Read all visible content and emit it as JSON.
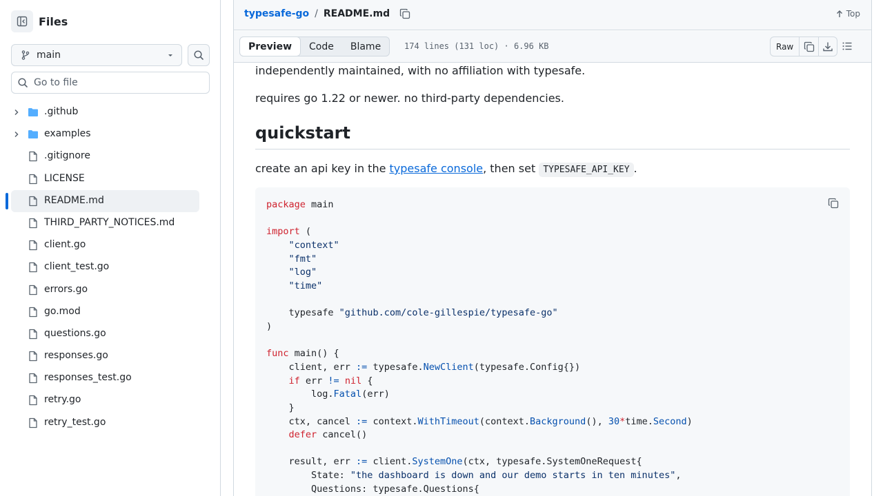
{
  "sidebar": {
    "title": "Files",
    "branch": "main",
    "goto_placeholder": "Go to file",
    "items": [
      {
        "name": ".github",
        "type": "folder"
      },
      {
        "name": "examples",
        "type": "folder"
      },
      {
        "name": ".gitignore",
        "type": "file"
      },
      {
        "name": "LICENSE",
        "type": "file"
      },
      {
        "name": "README.md",
        "type": "file",
        "selected": true
      },
      {
        "name": "THIRD_PARTY_NOTICES.md",
        "type": "file"
      },
      {
        "name": "client.go",
        "type": "file"
      },
      {
        "name": "client_test.go",
        "type": "file"
      },
      {
        "name": "errors.go",
        "type": "file"
      },
      {
        "name": "go.mod",
        "type": "file"
      },
      {
        "name": "questions.go",
        "type": "file"
      },
      {
        "name": "responses.go",
        "type": "file"
      },
      {
        "name": "responses_test.go",
        "type": "file"
      },
      {
        "name": "retry.go",
        "type": "file"
      },
      {
        "name": "retry_test.go",
        "type": "file"
      }
    ]
  },
  "header": {
    "repo": "typesafe-go",
    "separator": "/",
    "file": "README.md",
    "top_label": "Top"
  },
  "toolbar": {
    "tabs": [
      "Preview",
      "Code",
      "Blame"
    ],
    "active_tab": "Preview",
    "meta": "174 lines (131 loc) · 6.96 KB",
    "raw_label": "Raw"
  },
  "readme": {
    "p1": "independently maintained, with no affiliation with typesafe.",
    "p2": "requires go 1.22 or newer. no third-party dependencies.",
    "heading": "quickstart",
    "p3_before": "create an api key in the ",
    "p3_link": "typesafe console",
    "p3_middle": ", then set ",
    "p3_code": "TYPESAFE_API_KEY",
    "p3_after": ".",
    "code_lines": [
      [
        [
          "kw",
          "package"
        ],
        [
          "t",
          " main"
        ]
      ],
      [],
      [
        [
          "kw",
          "import"
        ],
        [
          "t",
          " ("
        ]
      ],
      [
        [
          "t",
          "    "
        ],
        [
          "str",
          "\"context\""
        ]
      ],
      [
        [
          "t",
          "    "
        ],
        [
          "str",
          "\"fmt\""
        ]
      ],
      [
        [
          "t",
          "    "
        ],
        [
          "str",
          "\"log\""
        ]
      ],
      [
        [
          "t",
          "    "
        ],
        [
          "str",
          "\"time\""
        ]
      ],
      [],
      [
        [
          "t",
          "    typesafe "
        ],
        [
          "str",
          "\"github.com/cole-gillespie/typesafe-go\""
        ]
      ],
      [
        [
          "t",
          ")"
        ]
      ],
      [],
      [
        [
          "kw",
          "func"
        ],
        [
          "t",
          " main() {"
        ]
      ],
      [
        [
          "t",
          "    client, err "
        ],
        [
          "op",
          ":="
        ],
        [
          "t",
          " typesafe."
        ],
        [
          "fn",
          "NewClient"
        ],
        [
          "t",
          "(typesafe.Config{})"
        ]
      ],
      [
        [
          "t",
          "    "
        ],
        [
          "kw",
          "if"
        ],
        [
          "t",
          " err "
        ],
        [
          "op",
          "!="
        ],
        [
          "t",
          " "
        ],
        [
          "kw",
          "nil"
        ],
        [
          "t",
          " {"
        ]
      ],
      [
        [
          "t",
          "        log."
        ],
        [
          "fn",
          "Fatal"
        ],
        [
          "t",
          "(err)"
        ]
      ],
      [
        [
          "t",
          "    }"
        ]
      ],
      [
        [
          "t",
          "    ctx, cancel "
        ],
        [
          "op",
          ":="
        ],
        [
          "t",
          " context."
        ],
        [
          "fn",
          "WithTimeout"
        ],
        [
          "t",
          "(context."
        ],
        [
          "fn",
          "Background"
        ],
        [
          "t",
          "(), "
        ],
        [
          "op",
          "30"
        ],
        [
          "kw",
          "*"
        ],
        [
          "t",
          "time."
        ],
        [
          "fn",
          "Second"
        ],
        [
          "t",
          ")"
        ]
      ],
      [
        [
          "t",
          "    "
        ],
        [
          "kw",
          "defer"
        ],
        [
          "t",
          " cancel()"
        ]
      ],
      [],
      [
        [
          "t",
          "    result, err "
        ],
        [
          "op",
          ":="
        ],
        [
          "t",
          " client."
        ],
        [
          "fn",
          "SystemOne"
        ],
        [
          "t",
          "(ctx, typesafe.SystemOneRequest{"
        ]
      ],
      [
        [
          "t",
          "        State: "
        ],
        [
          "str",
          "\"the dashboard is down and our demo starts in ten minutes\""
        ],
        [
          "t",
          ","
        ]
      ],
      [
        [
          "t",
          "        Questions: typesafe.Questions{"
        ]
      ]
    ]
  }
}
